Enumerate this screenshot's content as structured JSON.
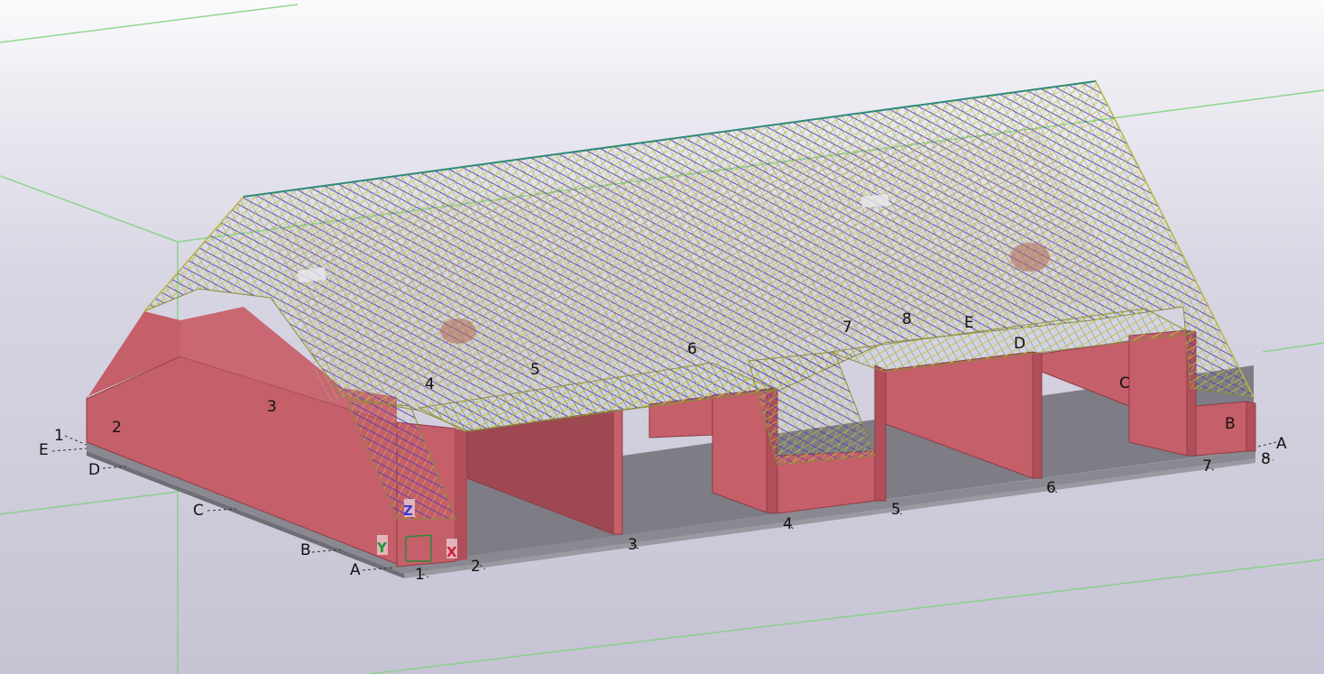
{
  "view": {
    "grid_labels": {
      "front_numbers": [
        "1",
        "2",
        "3",
        "4",
        "5",
        "6",
        "7",
        "8"
      ],
      "left_letters": [
        "1",
        "E",
        "D",
        "C",
        "B",
        "A"
      ],
      "right_letters": [
        "A"
      ],
      "model_numbers": [
        "2",
        "3",
        "4",
        "5",
        "6",
        "7",
        "8"
      ],
      "model_letters": [
        "E",
        "D",
        "C",
        "B"
      ]
    },
    "axes": {
      "x": "X",
      "y": "Y",
      "z": "Z"
    },
    "colors": {
      "wall": "#c55f6a",
      "wall_dark": "#9e4852",
      "slab": "#8a8890",
      "rebar_yellow": "#c8c23a",
      "rebar_purple": "#5a3ab8",
      "rebar_teal": "#2e8a7a",
      "work_area": "#7dd27d"
    }
  }
}
